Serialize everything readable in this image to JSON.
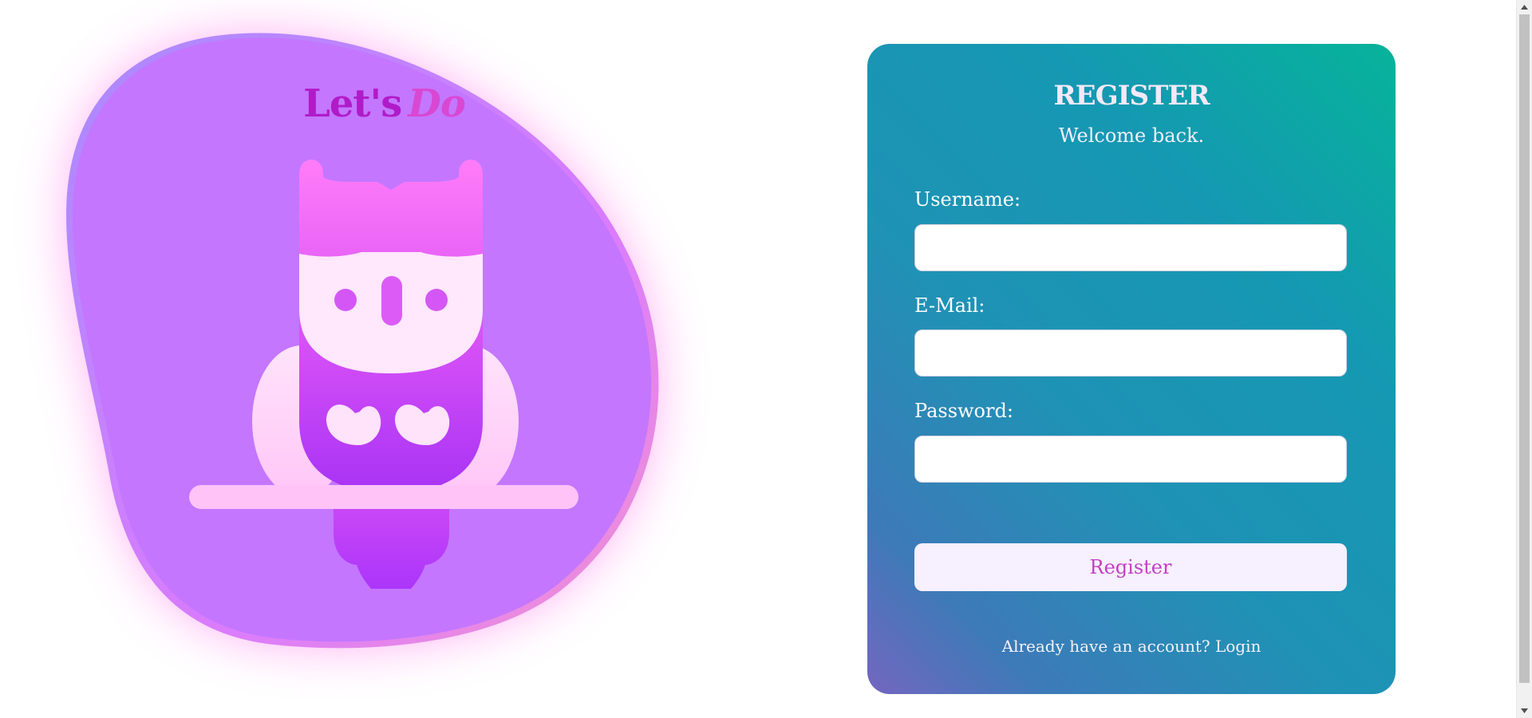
{
  "brand": {
    "part1": "Let's",
    "part2": "Do",
    "colors": {
      "part1": "#b01bc9",
      "part2": "#d848d2",
      "blob": "#c476ff"
    }
  },
  "hero": {
    "illustration": "owl-icon"
  },
  "register": {
    "title": "REGISTER",
    "subtitle": "Welcome back.",
    "fields": [
      {
        "label": "Username:",
        "value": "",
        "placeholder": ""
      },
      {
        "label": "E-Mail:",
        "value": "",
        "placeholder": ""
      },
      {
        "label": "Password:",
        "value": "",
        "placeholder": ""
      }
    ],
    "submit_label": "Register",
    "footer_text": "Already have an account?",
    "footer_link": "Login",
    "colors": {
      "gradient_start": "#06b39a",
      "gradient_end": "#7466c0",
      "button_text": "#c33fc4"
    }
  },
  "scrollbar": {
    "up_icon": "chevron-up-icon",
    "down_icon": "chevron-down-icon"
  }
}
